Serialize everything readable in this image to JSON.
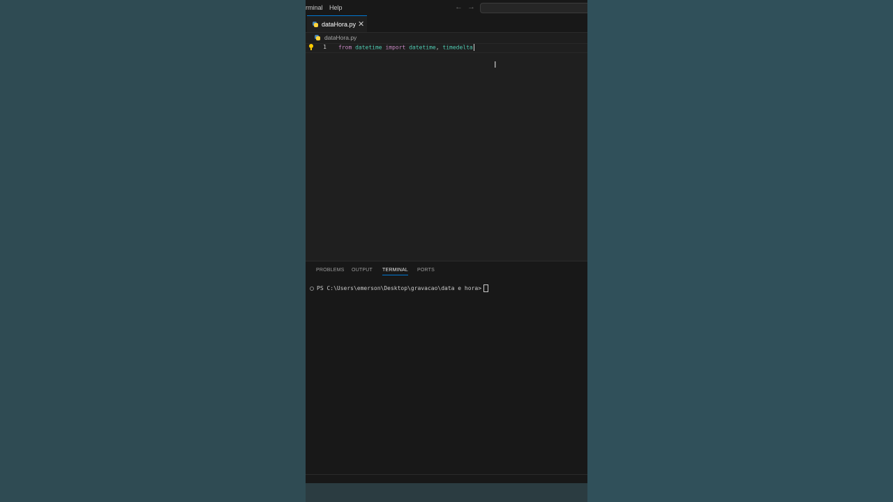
{
  "menu": {
    "terminal_label": "rminal",
    "help_label": "Help"
  },
  "tabs": [
    {
      "label": "dataHora.py",
      "active": true,
      "close_glyph": "✕"
    }
  ],
  "breadcrumb": {
    "file": "dataHora.py"
  },
  "editor": {
    "line_number": "1",
    "code": {
      "from": "from",
      "module": "datetime",
      "import": "import",
      "name1": "datetime",
      "comma": ",",
      "name2": "timedelta"
    }
  },
  "panel": {
    "tabs": [
      "PROBLEMS",
      "OUTPUT",
      "TERMINAL",
      "PORTS"
    ],
    "active_tab": "TERMINAL",
    "terminal_prompt": "PS C:\\Users\\emerson\\Desktop\\gravacao\\data e hora>"
  },
  "colors": {
    "background": "#2f4c54",
    "editor_bg": "#1f1f1f",
    "accent": "#0078d4",
    "keyword": "#c586c0",
    "module": "#4ec9b0"
  },
  "icons": {
    "back": "arrow-left-icon",
    "forward": "arrow-right-icon",
    "file": "python-file-icon",
    "lightbulb": "lightbulb-icon"
  }
}
